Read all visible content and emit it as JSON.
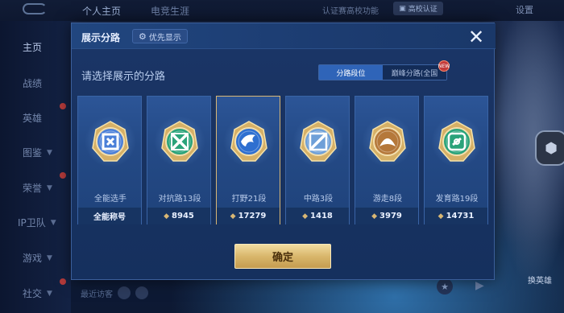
{
  "background": {
    "tabs": [
      "个人主页",
      "电竞生涯"
    ],
    "verify_text": "认证赛高校功能",
    "cert_label": "高校认证",
    "settings_label": "设置",
    "sidebar": [
      {
        "label": "主页",
        "chev": false,
        "dot": false
      },
      {
        "label": "战绩",
        "chev": false,
        "dot": false
      },
      {
        "label": "英雄",
        "chev": false,
        "dot": true
      },
      {
        "label": "图鉴",
        "chev": true,
        "dot": false
      },
      {
        "label": "荣誉",
        "chev": true,
        "dot": true
      },
      {
        "label": "IP卫队",
        "chev": true,
        "dot": false
      },
      {
        "label": "游戏",
        "chev": true,
        "dot": false
      },
      {
        "label": "社交",
        "chev": true,
        "dot": true
      }
    ],
    "bottom_left_text": "最近访客",
    "bottom_right_text": "换英雄"
  },
  "modal": {
    "title": "展示分路",
    "priority_label": "优先显示",
    "close_symbol": "✕",
    "subtitle": "请选择展示的分路",
    "toggle": {
      "options": [
        "分路段位",
        "巅峰分路(全国"
      ],
      "active_index": 0,
      "new_badge": "NEW"
    },
    "cards": [
      {
        "name": "全能选手",
        "value": "全能称号",
        "show_icon": false,
        "emblem": "allround",
        "color": "#4a7fd8"
      },
      {
        "name": "对抗路13段",
        "value": "8945",
        "show_icon": true,
        "emblem": "clash",
        "color": "#2aa37a"
      },
      {
        "name": "打野21段",
        "value": "17279",
        "show_icon": true,
        "emblem": "jungle",
        "color": "#2e6fd0"
      },
      {
        "name": "中路3段",
        "value": "1418",
        "show_icon": true,
        "emblem": "mid",
        "color": "#6fa0d8"
      },
      {
        "name": "游走8段",
        "value": "3979",
        "show_icon": true,
        "emblem": "roam",
        "color": "#b5783a"
      },
      {
        "name": "发育路19段",
        "value": "14731",
        "show_icon": true,
        "emblem": "farm",
        "color": "#2aa37a"
      }
    ],
    "selected_index": 2,
    "confirm_label": "确定"
  }
}
